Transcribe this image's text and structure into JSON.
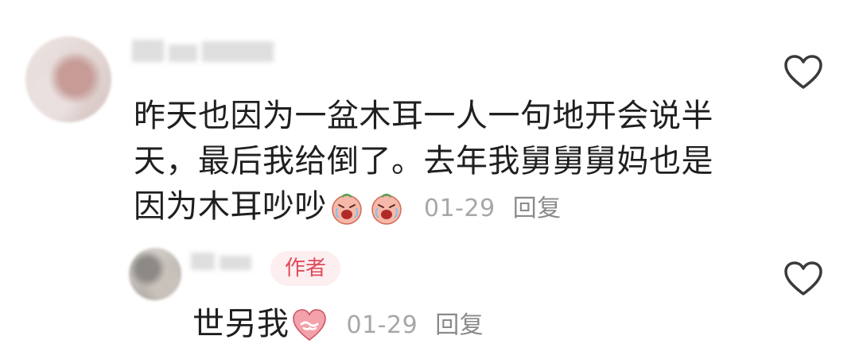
{
  "comments": [
    {
      "text_lines": [
        "昨天也因为一盆木耳一人一句地开会说半",
        "天，最后我给倒了。去年我舅舅舅妈也是",
        "因为木耳吵吵"
      ],
      "emojis": [
        "crying-face-emoji",
        "crying-face-emoji"
      ],
      "time": "01-29",
      "reply_label": "回复",
      "like_icon": "heart-outline-icon"
    },
    {
      "badge": "作者",
      "text": "世另我",
      "emojis": [
        "handshake-heart-emoji"
      ],
      "time": "01-29",
      "reply_label": "回复",
      "like_icon": "heart-outline-icon"
    }
  ],
  "colors": {
    "badge_text": "#e04a5a",
    "badge_bg": "#fdeef0",
    "time": "#a7a7a7",
    "reply": "#8a8a8a",
    "icon": "#3a3a3a"
  }
}
